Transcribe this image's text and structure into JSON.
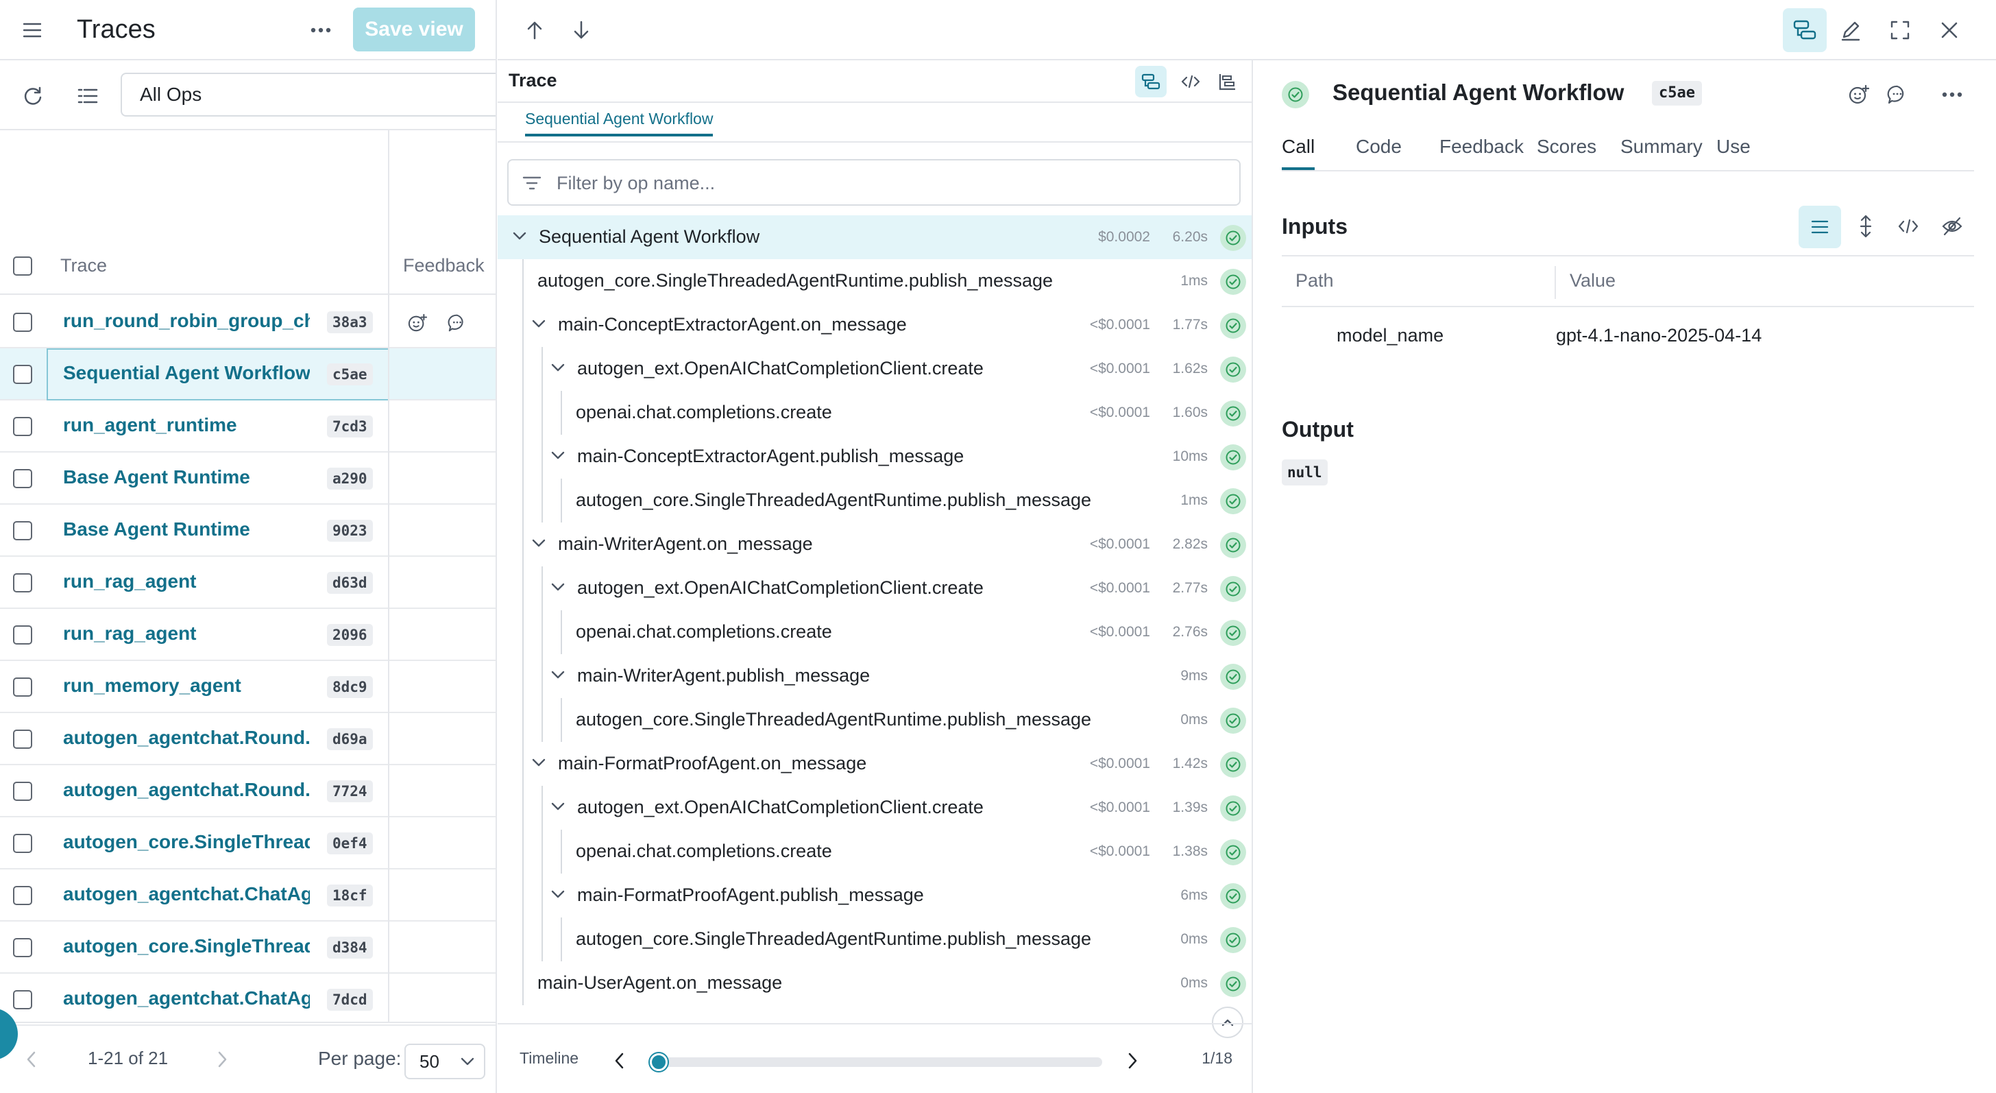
{
  "left": {
    "title": "Traces",
    "save_view": "Save view",
    "ops_filter": "All Ops",
    "col_trace": "Trace",
    "col_feedback": "Feedback",
    "rows": [
      {
        "name": "run_round_robin_group_chat",
        "hash": "38a3"
      },
      {
        "name": "Sequential Agent Workflow",
        "hash": "c5ae"
      },
      {
        "name": "run_agent_runtime",
        "hash": "7cd3"
      },
      {
        "name": "Base Agent Runtime",
        "hash": "a290"
      },
      {
        "name": "Base Agent Runtime",
        "hash": "9023"
      },
      {
        "name": "run_rag_agent",
        "hash": "d63d"
      },
      {
        "name": "run_rag_agent",
        "hash": "2096"
      },
      {
        "name": "run_memory_agent",
        "hash": "8dc9"
      },
      {
        "name": "autogen_agentchat.Round...",
        "hash": "d69a"
      },
      {
        "name": "autogen_agentchat.Round...",
        "hash": "7724"
      },
      {
        "name": "autogen_core.SingleThread...",
        "hash": "0ef4"
      },
      {
        "name": "autogen_agentchat.ChatAg...",
        "hash": "18cf"
      },
      {
        "name": "autogen_core.SingleThread...",
        "hash": "d384"
      },
      {
        "name": "autogen_agentchat.ChatAg...",
        "hash": "7dcd"
      }
    ],
    "selected_index": 1,
    "pager_range": "1-21 of 21",
    "per_page_label": "Per page:",
    "per_page_value": "50"
  },
  "trace": {
    "title": "Trace",
    "breadcrumb": "Sequential Agent Workflow",
    "filter_placeholder": "Filter by op name...",
    "rows": [
      {
        "name": "Sequential Agent Workflow",
        "cost": "$0.0002",
        "dur": "6.20s",
        "depth": 0,
        "caret": true,
        "active": true
      },
      {
        "name": "autogen_core.SingleThreadedAgentRuntime.publish_message",
        "cost": "",
        "dur": "1ms",
        "depth": 1,
        "caret": false
      },
      {
        "name": "main-ConceptExtractorAgent.on_message",
        "cost": "<$0.0001",
        "dur": "1.77s",
        "depth": 1,
        "caret": true
      },
      {
        "name": "autogen_ext.OpenAIChatCompletionClient.create",
        "cost": "<$0.0001",
        "dur": "1.62s",
        "depth": 2,
        "caret": true
      },
      {
        "name": "openai.chat.completions.create",
        "cost": "<$0.0001",
        "dur": "1.60s",
        "depth": 3,
        "caret": false
      },
      {
        "name": "main-ConceptExtractorAgent.publish_message",
        "cost": "",
        "dur": "10ms",
        "depth": 2,
        "caret": true
      },
      {
        "name": "autogen_core.SingleThreadedAgentRuntime.publish_message",
        "cost": "",
        "dur": "1ms",
        "depth": 3,
        "caret": false
      },
      {
        "name": "main-WriterAgent.on_message",
        "cost": "<$0.0001",
        "dur": "2.82s",
        "depth": 1,
        "caret": true
      },
      {
        "name": "autogen_ext.OpenAIChatCompletionClient.create",
        "cost": "<$0.0001",
        "dur": "2.77s",
        "depth": 2,
        "caret": true
      },
      {
        "name": "openai.chat.completions.create",
        "cost": "<$0.0001",
        "dur": "2.76s",
        "depth": 3,
        "caret": false
      },
      {
        "name": "main-WriterAgent.publish_message",
        "cost": "",
        "dur": "9ms",
        "depth": 2,
        "caret": true
      },
      {
        "name": "autogen_core.SingleThreadedAgentRuntime.publish_message",
        "cost": "",
        "dur": "0ms",
        "depth": 3,
        "caret": false
      },
      {
        "name": "main-FormatProofAgent.on_message",
        "cost": "<$0.0001",
        "dur": "1.42s",
        "depth": 1,
        "caret": true
      },
      {
        "name": "autogen_ext.OpenAIChatCompletionClient.create",
        "cost": "<$0.0001",
        "dur": "1.39s",
        "depth": 2,
        "caret": true
      },
      {
        "name": "openai.chat.completions.create",
        "cost": "<$0.0001",
        "dur": "1.38s",
        "depth": 3,
        "caret": false
      },
      {
        "name": "main-FormatProofAgent.publish_message",
        "cost": "",
        "dur": "6ms",
        "depth": 2,
        "caret": true
      },
      {
        "name": "autogen_core.SingleThreadedAgentRuntime.publish_message",
        "cost": "",
        "dur": "0ms",
        "depth": 3,
        "caret": false
      },
      {
        "name": "main-UserAgent.on_message",
        "cost": "",
        "dur": "0ms",
        "depth": 1,
        "caret": false
      }
    ],
    "timeline_label": "Timeline",
    "timeline_count": "1/18",
    "timeline_position": 0.0
  },
  "detail": {
    "title": "Sequential Agent Workflow",
    "hash": "c5ae",
    "tabs": [
      "Call",
      "Code",
      "Feedback",
      "Scores",
      "Summary",
      "Use"
    ],
    "active_tab": 0,
    "inputs_title": "Inputs",
    "col_path": "Path",
    "col_value": "Value",
    "input_key": "model_name",
    "input_value": "gpt-4.1-nano-2025-04-14",
    "output_title": "Output",
    "output_value": "null"
  },
  "colors": {
    "accent": "#13708a",
    "success_bg": "#c9ebd6",
    "success_fg": "#2f9e5b",
    "selected_bg": "#e3f5f9"
  }
}
